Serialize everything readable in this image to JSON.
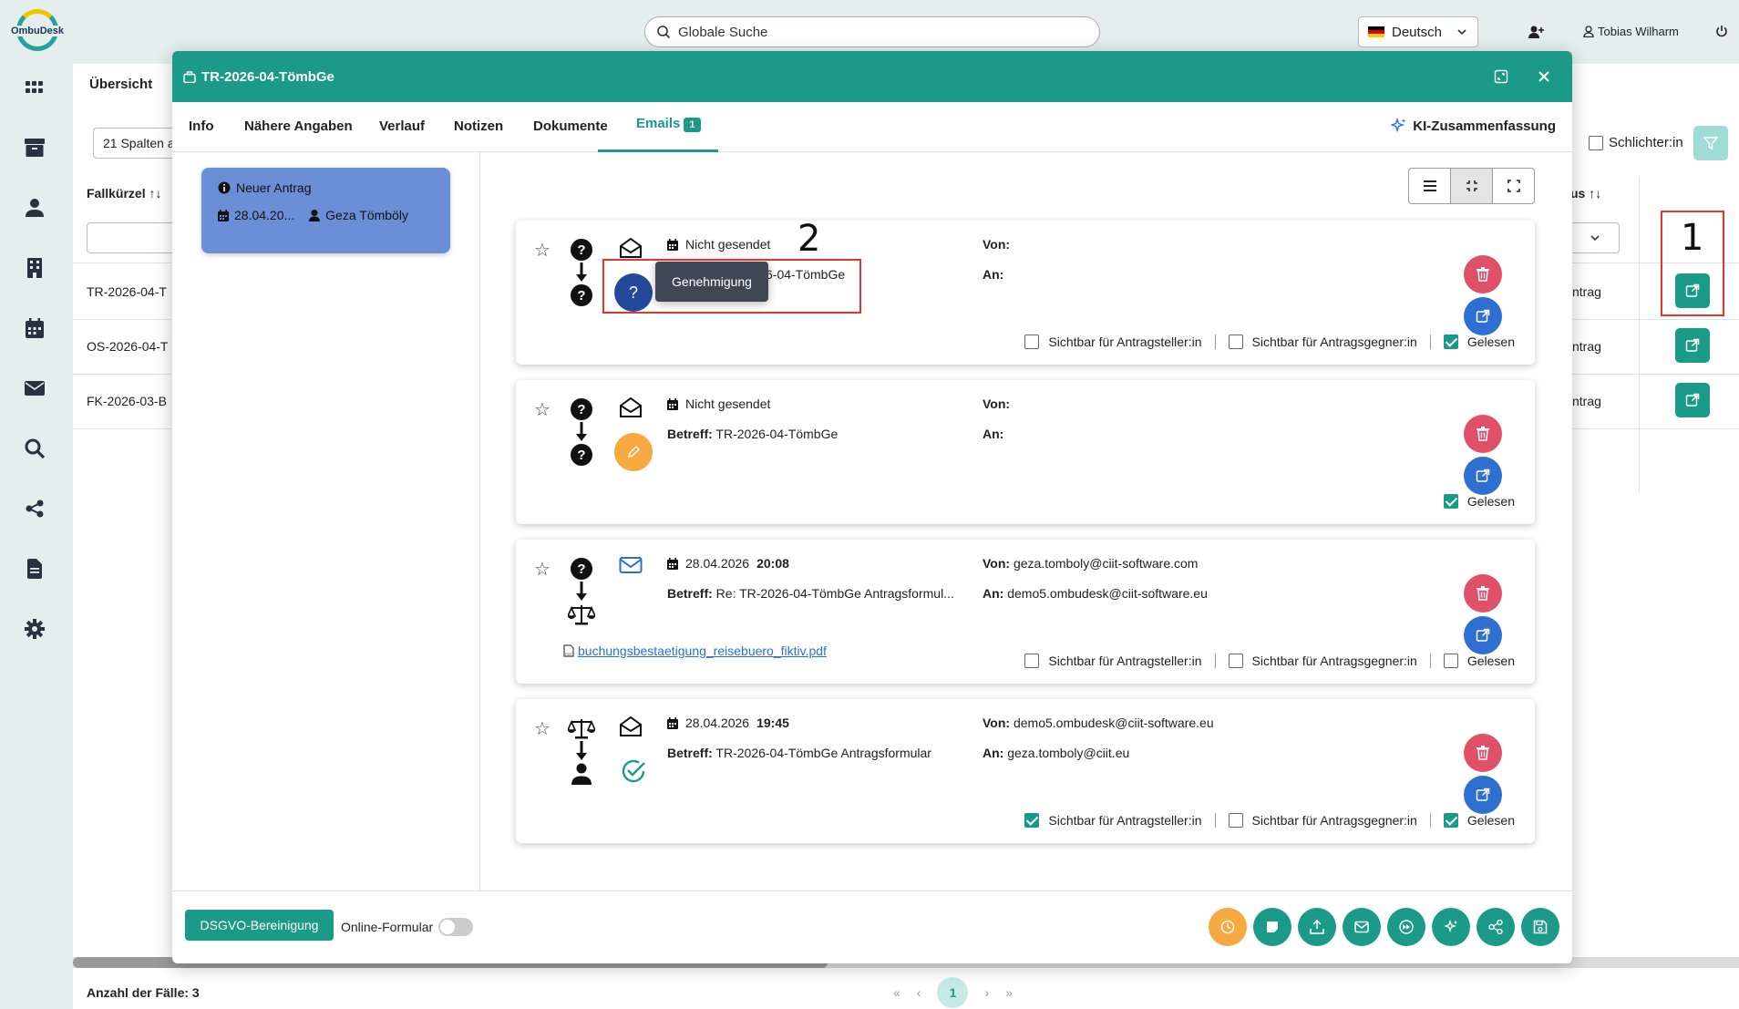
{
  "app": {
    "logo_text": "OmbuDesk",
    "search_placeholder": "Globale Suche",
    "language": "Deutsch",
    "user": "Tobias Wilharm"
  },
  "background": {
    "tab": "Übersicht",
    "columns_select": "21 Spalten a",
    "col_header_left": "Fallkürzel",
    "col_header_right": "us",
    "rows": [
      {
        "id": "TR-2026-04-T",
        "status": "ntrag"
      },
      {
        "id": "OS-2026-04-T",
        "status": "ntrag"
      },
      {
        "id": "FK-2026-03-B",
        "status": "ntrag"
      }
    ],
    "schlichter_label": "Schlichter:in",
    "count_label": "Anzahl der Fälle: 3",
    "pager": {
      "first": "«",
      "prev": "‹",
      "current": "1",
      "next": "›",
      "last": "»"
    }
  },
  "annotations": {
    "one": "1",
    "two": "2"
  },
  "modal": {
    "title": "TR-2026-04-TömbGe",
    "tabs": [
      {
        "label": "Info"
      },
      {
        "label": "Nähere Angaben"
      },
      {
        "label": "Verlauf"
      },
      {
        "label": "Notizen"
      },
      {
        "label": "Dokumente"
      },
      {
        "label": "Emails",
        "badge": "1"
      }
    ],
    "ki_label": "KI-Zusammenfassung",
    "case_card": {
      "status": "Neuer Antrag",
      "date": "28.04.20...",
      "person": "Geza Tömböly"
    },
    "tooltip": "Genehmigung",
    "labels": {
      "von": "Von:",
      "an": "An:",
      "betreff": "Betreff:",
      "sichtbar_steller": "Sichtbar für Antragsteller:in",
      "sichtbar_gegner": "Sichtbar für Antragsgegner:in",
      "gelesen": "Gelesen"
    },
    "emails": [
      {
        "date": "Nicht gesendet",
        "time": "",
        "subject": "TR-2026-04-TömbGe",
        "subject_visible": "6-04-TömbGe",
        "von": "",
        "an": "",
        "status_icon": "question-icon",
        "status_color": "#234a9a",
        "sichtbar_steller": false,
        "sichtbar_gegner": false,
        "gelesen": true
      },
      {
        "date": "Nicht gesendet",
        "time": "",
        "subject": "TR-2026-04-TömbGe",
        "von": "",
        "an": "",
        "status_icon": "pencil-icon",
        "status_color": "#f6a940",
        "gelesen": true
      },
      {
        "date": "28.04.2026",
        "time": "20:08",
        "subject": "Re: TR-2026-04-TömbGe Antragsformul...",
        "von": "geza.tomboly@ciit-software.com",
        "an": "demo5.ombudesk@ciit-software.eu",
        "attachment": "buchungsbestaetigung_reisebuero_fiktiv.pdf",
        "sichtbar_steller": false,
        "sichtbar_gegner": false,
        "gelesen": false
      },
      {
        "date": "28.04.2026",
        "time": "19:45",
        "subject": "TR-2026-04-TömbGe Antragsformular",
        "von": "demo5.ombudesk@ciit-software.eu",
        "an": "geza.tomboly@ciit.eu",
        "status_icon": "check-circle-icon",
        "sichtbar_steller": true,
        "sichtbar_gegner": false,
        "gelesen": true
      }
    ],
    "footer": {
      "dsgvo": "DSGVO-Bereinigung",
      "online_form": "Online-Formular"
    }
  },
  "colors": {
    "accent": "#1b9a8a",
    "danger": "#e05066",
    "primary": "#2f6fd1",
    "warning": "#f6a940",
    "annotation": "#e0362c"
  }
}
